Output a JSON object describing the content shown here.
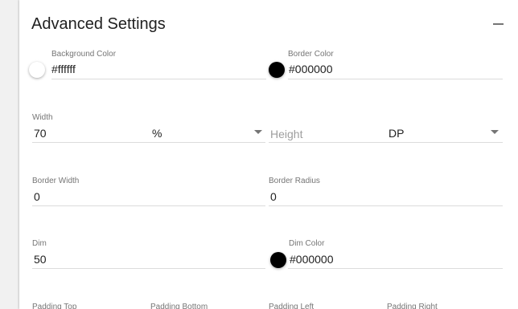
{
  "panel": {
    "title": "Advanced Settings",
    "collapse_symbol": "minus-icon"
  },
  "background_color": {
    "label": "Background Color",
    "value": "#ffffff"
  },
  "border_color": {
    "label": "Border Color",
    "value": "#000000"
  },
  "width": {
    "label": "Width",
    "value": "70",
    "unit": "%"
  },
  "height": {
    "placeholder": "Height",
    "unit": "DP"
  },
  "border_width": {
    "label": "Border Width",
    "value": "0"
  },
  "border_radius": {
    "label": "Border Radius",
    "value": "0"
  },
  "dim": {
    "label": "Dim",
    "value": "50"
  },
  "dim_color": {
    "label": "Dim Color",
    "value": "#000000"
  },
  "padding": {
    "top_label": "Padding Top",
    "bottom_label": "Padding Bottom",
    "left_label": "Padding Left",
    "right_label": "Padding Right"
  },
  "colors": {
    "swatch_white": "#ffffff",
    "swatch_black": "#000000",
    "text_primary": "#212121",
    "text_secondary": "#757575"
  }
}
